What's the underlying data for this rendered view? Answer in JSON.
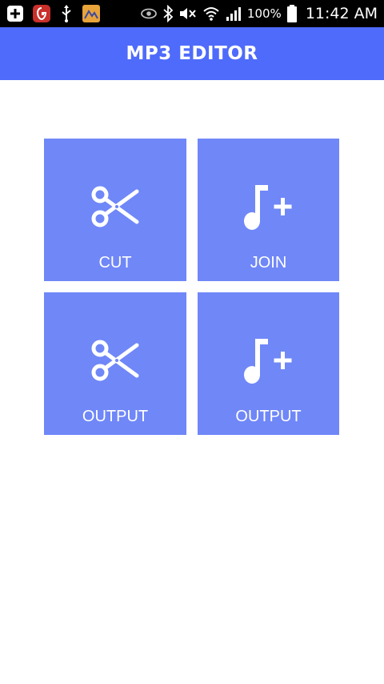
{
  "status_bar": {
    "battery": "100%",
    "time": "11:42 AM",
    "icons": [
      "add-icon",
      "shield-app-icon",
      "usb-icon",
      "image-app-icon",
      "eye-icon",
      "bluetooth-icon",
      "mute-icon",
      "wifi-icon",
      "signal-icon",
      "battery-icon"
    ]
  },
  "app_bar": {
    "title": "MP3 EDITOR",
    "color": "#4f6bfb"
  },
  "tiles": [
    {
      "label": "CUT",
      "icon": "scissors-icon"
    },
    {
      "label": "JOIN",
      "icon": "music-note-plus-icon"
    },
    {
      "label": "OUTPUT",
      "icon": "scissors-icon"
    },
    {
      "label": "OUTPUT",
      "icon": "music-note-plus-icon"
    }
  ],
  "tile_color": "#6f87f7"
}
